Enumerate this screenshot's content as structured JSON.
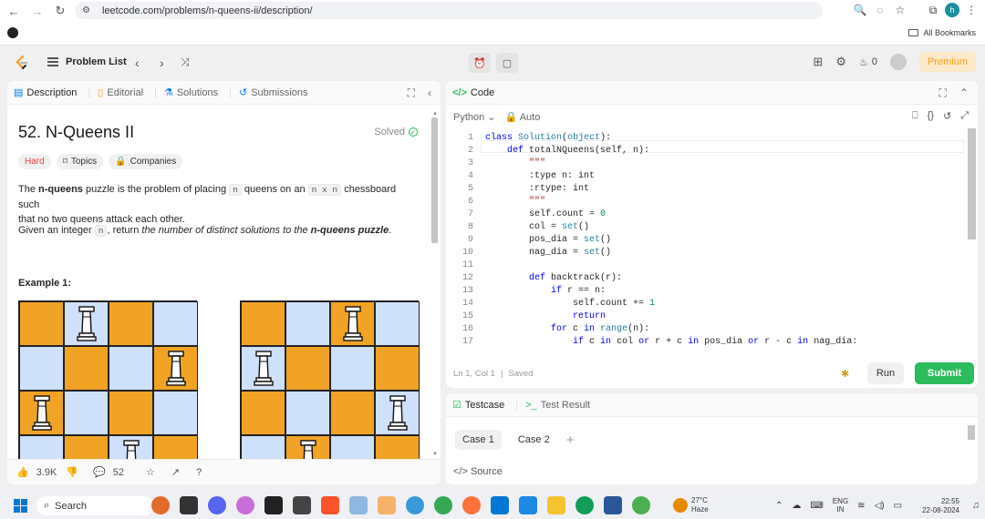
{
  "browser": {
    "url": "leetcode.com/problems/n-queens-ii/description/",
    "bookmarks_label": "All Bookmarks",
    "profile_initial": "h"
  },
  "header": {
    "problem_list": "Problem List",
    "streak": "0",
    "premium": "Premium"
  },
  "left_tabs": [
    {
      "label": "Description",
      "icon": "document-icon"
    },
    {
      "label": "Editorial",
      "icon": "book-icon"
    },
    {
      "label": "Solutions",
      "icon": "flask-icon"
    },
    {
      "label": "Submissions",
      "icon": "history-icon"
    }
  ],
  "problem": {
    "title": "52. N-Queens II",
    "status": "Solved",
    "difficulty": "Hard",
    "topics": "Topics",
    "companies": "Companies",
    "p1_a": "The ",
    "p1_b": "n-queens",
    "p1_c": " puzzle is the problem of placing ",
    "p1_code1": "n",
    "p1_d": " queens on an ",
    "p1_code2": "n x n",
    "p1_e": " chessboard such",
    "p1_f": "that no two queens attack each other.",
    "p2_a": "Given an integer ",
    "p2_code": "n",
    "p2_b": ", return ",
    "p2_c": "the number of distinct solutions to the ",
    "p2_d": "n-queens puzzle",
    "p2_e": ".",
    "example_label": "Example 1:",
    "board1_queens": [
      [
        0,
        1
      ],
      [
        1,
        3
      ],
      [
        2,
        0
      ],
      [
        3,
        2
      ]
    ],
    "board2_queens": [
      [
        0,
        2
      ],
      [
        1,
        0
      ],
      [
        2,
        3
      ],
      [
        3,
        1
      ]
    ]
  },
  "footer": {
    "likes": "3.9K",
    "comments": "52"
  },
  "code_panel": {
    "title": "Code",
    "language": "Python",
    "mode": "Auto",
    "status_pos": "Ln 1, Col 1",
    "status_saved": "Saved",
    "run": "Run",
    "submit": "Submit",
    "lines": [
      {
        "n": "1",
        "t": "class Solution(object):"
      },
      {
        "n": "2",
        "t": "    def totalNQueens(self, n):"
      },
      {
        "n": "3",
        "t": "        \"\"\""
      },
      {
        "n": "4",
        "t": "        :type n: int"
      },
      {
        "n": "5",
        "t": "        :rtype: int"
      },
      {
        "n": "6",
        "t": "        \"\"\""
      },
      {
        "n": "7",
        "t": "        self.count = 0"
      },
      {
        "n": "8",
        "t": "        col = set()"
      },
      {
        "n": "9",
        "t": "        pos_dia = set()"
      },
      {
        "n": "10",
        "t": "        nag_dia = set()"
      },
      {
        "n": "11",
        "t": ""
      },
      {
        "n": "12",
        "t": "        def backtrack(r):"
      },
      {
        "n": "13",
        "t": "            if r == n:"
      },
      {
        "n": "14",
        "t": "                self.count += 1"
      },
      {
        "n": "15",
        "t": "                return"
      },
      {
        "n": "16",
        "t": "            for c in range(n):"
      },
      {
        "n": "17",
        "t": "                if c in col or r + c in pos_dia or r - c in nag_dia:"
      }
    ]
  },
  "test_panel": {
    "testcase": "Testcase",
    "test_result": "Test Result",
    "case1": "Case 1",
    "case2": "Case 2",
    "source": "Source"
  },
  "taskbar": {
    "search": "Search",
    "temp": "27°C",
    "weather": "Haze",
    "lang1": "ENG",
    "lang2": "IN",
    "time": "22:55",
    "date": "22-08-2024"
  },
  "colors": {
    "accent_orange": "#ffa116",
    "submit_green": "#2cbb5d",
    "hard_red": "#ef4743",
    "board_orange": "#f0a324",
    "board_blue": "#cfe0fa"
  }
}
